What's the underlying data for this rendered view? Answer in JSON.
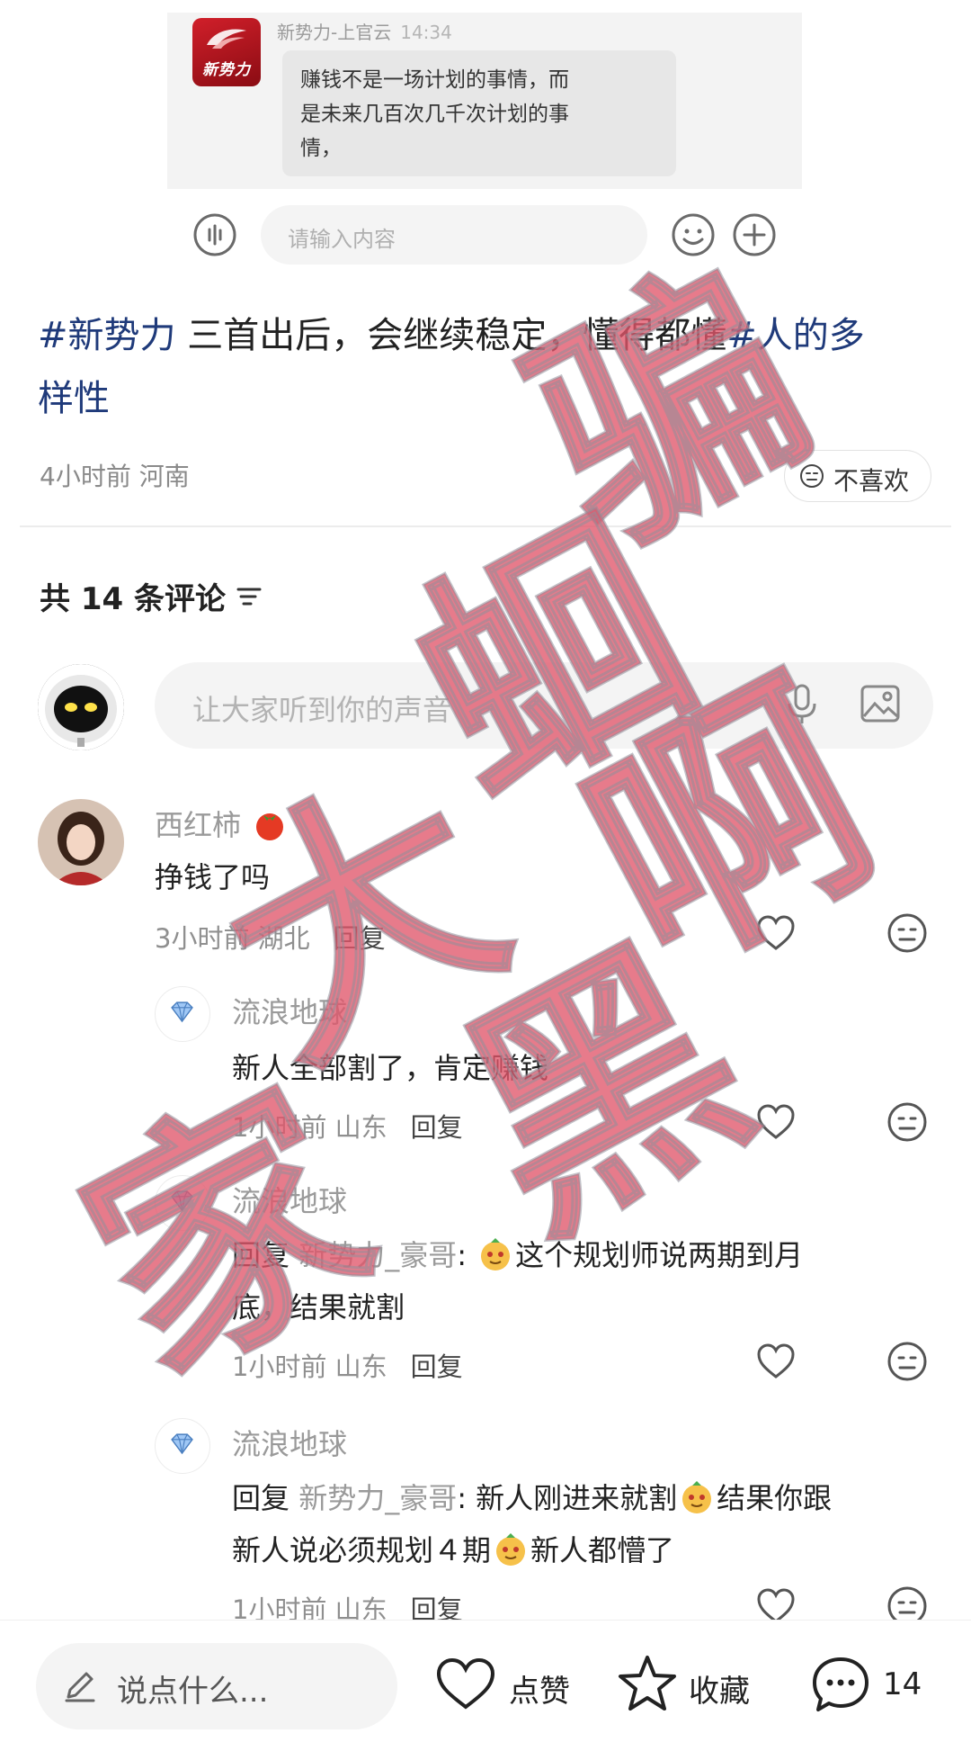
{
  "chat": {
    "sender": "新势力-上官云",
    "time": "14:34",
    "avatar_text": "新势力",
    "message_lines": [
      "赚钱不是一场计划的事情，而",
      "是未来几百次几千次计划的事",
      "情，"
    ],
    "input_placeholder": "请输入内容"
  },
  "post": {
    "tag1": "#新势力",
    "text_mid": " 三首出后，会继续稳定，懂得都懂",
    "tag2_line1": "#人的多",
    "tag2_line2": "样性",
    "meta": "4小时前  河南",
    "dislike_label": "不喜欢"
  },
  "comments_section": {
    "title": "共 14 条评论",
    "input_placeholder": "让大家听到你的声音"
  },
  "comments": [
    {
      "name": "西红柿",
      "text": "挣钱了吗",
      "meta": "3小时前  湖北",
      "reply": "回复"
    },
    {
      "name": "流浪地球",
      "text": "新人全部割了，肯定赚钱",
      "meta": "1小时前  山东",
      "reply": "回复"
    },
    {
      "name": "流浪地球",
      "reply_prefix": "回复",
      "mention": "新势力_豪哥",
      "text_line1": "这个规划师说两期到月",
      "text_line2": "底，结果就割",
      "meta": "1小时前  山东",
      "reply": "回复"
    },
    {
      "name": "流浪地球",
      "reply_prefix": "回复",
      "mention": "新势力_豪哥",
      "text_a": "新人刚进来就割",
      "text_b": "结果你跟",
      "text_line2a": "新人说必须规划４期",
      "text_line2b": "新人都懵了",
      "meta": "1小时前  山东",
      "reply": "回复"
    }
  ],
  "bottom_bar": {
    "input_placeholder": "说点什么...",
    "like_label": "点赞",
    "collect_label": "收藏",
    "comment_count": "14"
  },
  "watermark": {
    "chars": [
      "骗",
      "蛔",
      "啊",
      "大",
      "黑",
      "家"
    ]
  },
  "colors": {
    "hashtag": "#1f3a7a",
    "watermark": "#e0566a",
    "brand_red": "#c8141f"
  }
}
